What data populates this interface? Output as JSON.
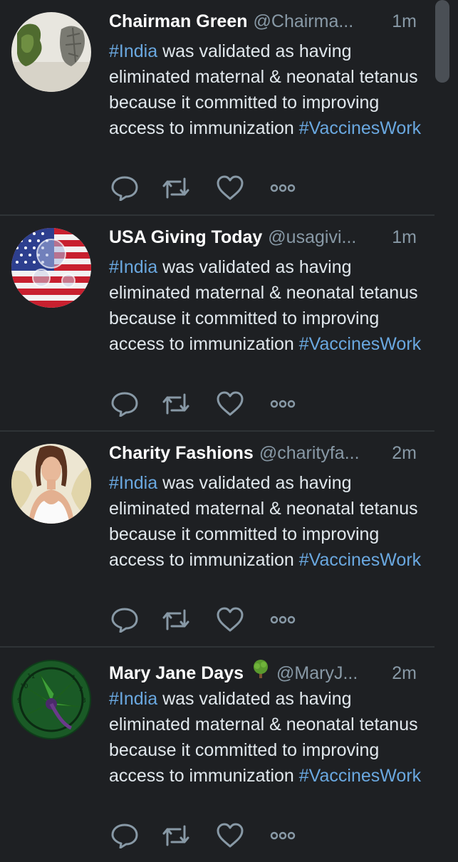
{
  "tweets": [
    {
      "name": "Chairman Green",
      "handle": "@Chairma...",
      "time": "1m",
      "badge": "",
      "hashtag_start": "#India",
      "text": " was validated as having eliminated maternal & neonatal tetanus because it committed to improving access to immunization ",
      "hashtag_end": "#VaccinesWork",
      "avatar_icon": "tree-head-silhouette-avatar"
    },
    {
      "name": "USA Giving Today",
      "handle": "@usagivi...",
      "time": "1m",
      "badge": "",
      "hashtag_start": "#India",
      "text": " was validated as having eliminated maternal & neonatal tetanus because it committed to improving access to immunization ",
      "hashtag_end": "#VaccinesWork",
      "avatar_icon": "us-flag-avatar"
    },
    {
      "name": "Charity Fashions",
      "handle": "@charityfa...",
      "time": "2m",
      "badge": "",
      "hashtag_start": "#India",
      "text": " was validated as having eliminated maternal & neonatal tetanus because it committed to improving access to immunization ",
      "hashtag_end": "#VaccinesWork",
      "avatar_icon": "fashion-model-avatar"
    },
    {
      "name": "Mary Jane Days",
      "handle": "@MaryJ...",
      "time": "2m",
      "badge": "tree-emoji",
      "hashtag_start": "#India",
      "text": " was validated as having eliminated maternal & neonatal tetanus because it committed to improving access to immunization ",
      "hashtag_end": "#VaccinesWork",
      "avatar_icon": "cannabis-leaf-clock-avatar"
    }
  ],
  "actions": {
    "reply": "reply-icon",
    "retweet": "retweet-icon",
    "like": "like-icon",
    "more": "more-icon"
  },
  "colors": {
    "background": "#1e2023",
    "text": "#e1e8ed",
    "secondary_text": "#8899a6",
    "hashtag": "#6aa8e0",
    "divider": "#2f3336"
  }
}
